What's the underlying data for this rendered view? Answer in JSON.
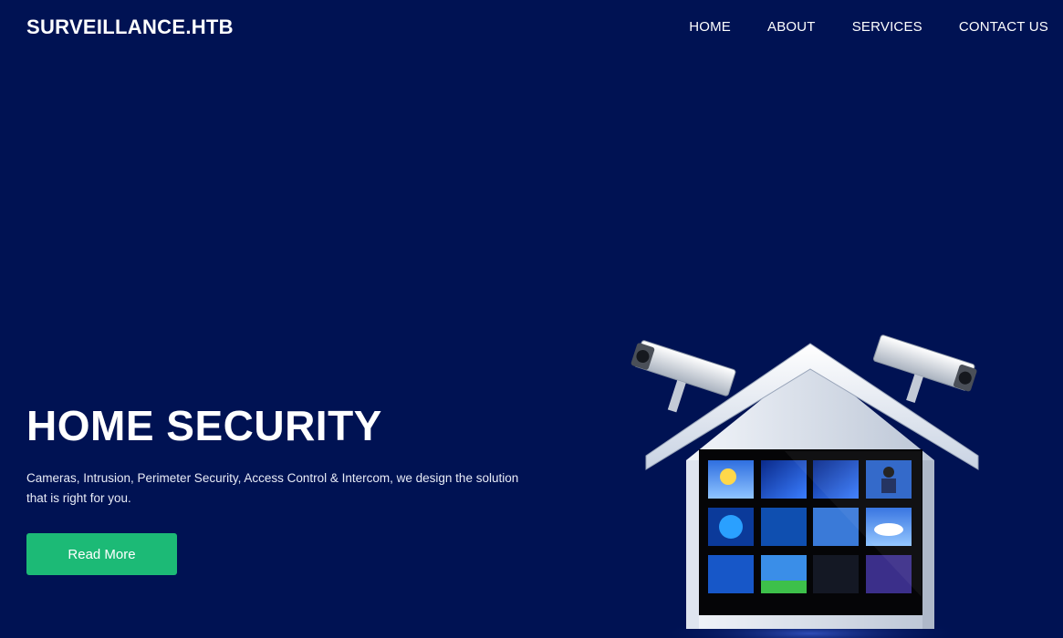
{
  "header": {
    "brand": "SURVEILLANCE.HTB",
    "nav": [
      {
        "label": "HOME"
      },
      {
        "label": "ABOUT"
      },
      {
        "label": "SERVICES"
      },
      {
        "label": "CONTACT US"
      }
    ]
  },
  "hero": {
    "title": "HOME SECURITY",
    "description": "Cameras, Intrusion, Perimeter Security, Access Control & Intercom, we design the solution that is right for you.",
    "button_label": "Read More"
  },
  "illustration": {
    "icon": "house-security-camera-icon"
  },
  "colors": {
    "background": "#001253",
    "button": "#1cba76",
    "text": "#ffffff"
  }
}
